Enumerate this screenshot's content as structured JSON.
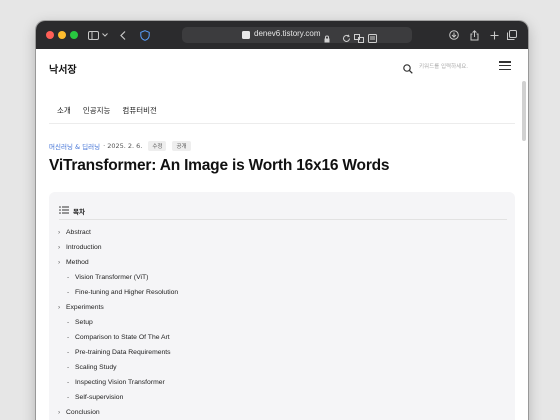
{
  "browser": {
    "url": "denev6.tistory.com"
  },
  "blog": {
    "name": "낙서장",
    "search_placeholder": "키워드를 입력하세요.",
    "nav": [
      "소개",
      "인공지능",
      "컴퓨터비전"
    ]
  },
  "post": {
    "category": "머신러닝 & 딥러닝",
    "date": "· 2025. 2. 6.",
    "badges": [
      "수정",
      "공개"
    ],
    "title": "ViTransformer: An Image is Worth 16x16 Words"
  },
  "toc": {
    "heading": "목차",
    "items": [
      {
        "label": "Abstract",
        "level": 1
      },
      {
        "label": "Introduction",
        "level": 1
      },
      {
        "label": "Method",
        "level": 1
      },
      {
        "label": "Vision Transformer (ViT)",
        "level": 2
      },
      {
        "label": "Fine-tuning and Higher Resolution",
        "level": 2
      },
      {
        "label": "Experiments",
        "level": 1
      },
      {
        "label": "Setup",
        "level": 2
      },
      {
        "label": "Comparison to State Of The Art",
        "level": 2
      },
      {
        "label": "Pre-training Data Requirements",
        "level": 2
      },
      {
        "label": "Scaling Study",
        "level": 2
      },
      {
        "label": "Inspecting Vision Transformer",
        "level": 2
      },
      {
        "label": "Self-supervision",
        "level": 2
      },
      {
        "label": "Conclusion",
        "level": 1
      }
    ]
  },
  "colors": {
    "accent_link": "#3d6fd6",
    "browser_toolbar": "#2b2b2d"
  }
}
